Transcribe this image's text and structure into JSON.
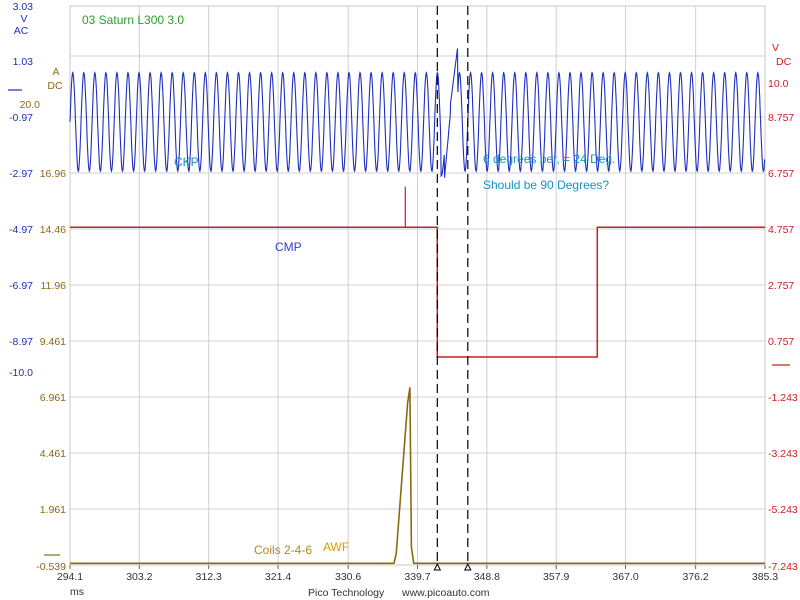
{
  "title": "03 Saturn L300 3.0",
  "footer": {
    "brand": "Pico Technology",
    "url": "www.picoauto.com"
  },
  "colors": {
    "channel_a": "#1f2fc0",
    "channel_b": "#cc1f1f",
    "channel_c": "#8a6a10",
    "awf": "#d8a000",
    "title": "#2aa02a",
    "annotation": "#1a8fc8",
    "grid": "#d0d0d0"
  },
  "left_axis_a": {
    "unit_lines": [
      "V",
      "AC"
    ],
    "ticks": [
      "3.03",
      "1.03",
      "-0.97",
      "-2.97",
      "-4.97",
      "-6.97",
      "-8.97",
      "-10.0"
    ]
  },
  "left_axis_c": {
    "unit_lines": [
      "A",
      "DC"
    ],
    "ticks": [
      "20.0",
      "16.96",
      "14.46",
      "11.96",
      "9.461",
      "6.961",
      "4.461",
      "1.961",
      "-0.539"
    ]
  },
  "right_axis_b": {
    "unit_lines": [
      "V",
      "DC"
    ],
    "ticks": [
      "10.0",
      "8.757",
      "6.757",
      "4.757",
      "2.757",
      "0.757",
      "-1.243",
      "-3.243",
      "-5.243",
      "-7.243"
    ]
  },
  "annotations": {
    "ckp": "CKP",
    "cmp": "CMP",
    "coils": "Coils 2-4-6",
    "awf": "AWF",
    "note1": "6 degrees per, = 24 Deg.",
    "note2": "Should be 90 Degrees?"
  },
  "chart_data": {
    "type": "line",
    "title": "03 Saturn L300 3.0",
    "xlabel": "ms",
    "x_ticks": [
      "294.1",
      "303.2",
      "312.3",
      "321.4",
      "330.6",
      "339.7",
      "348.8",
      "357.9",
      "367.0",
      "376.2",
      "385.3"
    ],
    "xlim": [
      294.1,
      385.3
    ],
    "grid": true,
    "cursors_ms": [
      342.3,
      346.3
    ],
    "series": [
      {
        "name": "CKP",
        "channel": "A",
        "unit": "V AC",
        "ylim": [
          -10.0,
          3.03
        ],
        "waveform": "sine",
        "amplitude": 1.2,
        "offset": 0.5,
        "period_ms": 1.45,
        "gap_ms": [
          342.8,
          345.0
        ]
      },
      {
        "name": "CMP",
        "channel": "B",
        "unit": "V DC",
        "ylim": [
          -7.243,
          10.0
        ],
        "points": [
          [
            294.1,
            4.85
          ],
          [
            342.3,
            4.85
          ],
          [
            342.3,
            0.22
          ],
          [
            363.3,
            0.22
          ],
          [
            363.3,
            4.85
          ],
          [
            385.3,
            4.85
          ]
        ],
        "spike": [
          338.1,
          6.3
        ]
      },
      {
        "name": "Coils 2-4-6",
        "channel": "C",
        "unit": "A DC",
        "ylim": [
          -0.539,
          20.0
        ],
        "points": [
          [
            294.1,
            -0.42
          ],
          [
            336.6,
            -0.42
          ],
          [
            336.9,
            0.0
          ],
          [
            338.4,
            6.7
          ],
          [
            338.7,
            7.4
          ],
          [
            338.9,
            0.3
          ],
          [
            339.2,
            -0.42
          ],
          [
            385.3,
            -0.42
          ]
        ]
      }
    ]
  }
}
